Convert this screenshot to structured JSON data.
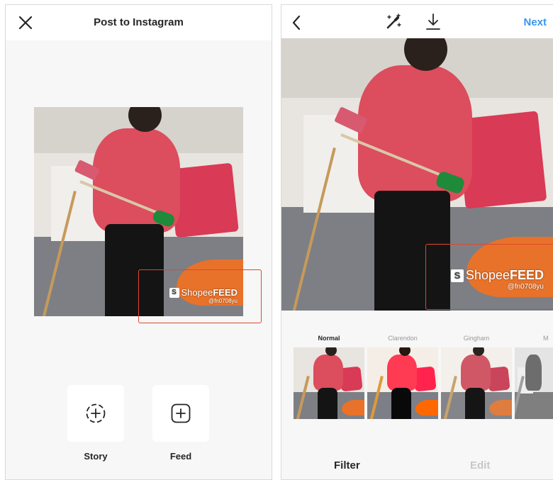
{
  "left": {
    "title": "Post to Instagram",
    "watermark": {
      "brand_light": "Shopee",
      "brand_bold": "FEED",
      "handle": "@fn0708yu"
    },
    "actions": [
      {
        "label": "Story",
        "icon": "story-add-icon"
      },
      {
        "label": "Feed",
        "icon": "feed-add-icon"
      }
    ]
  },
  "right": {
    "next_label": "Next",
    "watermark": {
      "brand_light": "Shopee",
      "brand_bold": "FEED",
      "handle": "@fn0708yu"
    },
    "filters": [
      {
        "label": "Normal",
        "selected": true
      },
      {
        "label": "Clarendon",
        "selected": false
      },
      {
        "label": "Gingham",
        "selected": false
      },
      {
        "label": "M",
        "selected": false
      }
    ],
    "tabs": [
      {
        "label": "Filter",
        "active": true
      },
      {
        "label": "Edit",
        "active": false
      }
    ]
  },
  "colors": {
    "accent": "#3897f0",
    "annotation": "#e0462f",
    "inactive": "#c7c7c7"
  }
}
